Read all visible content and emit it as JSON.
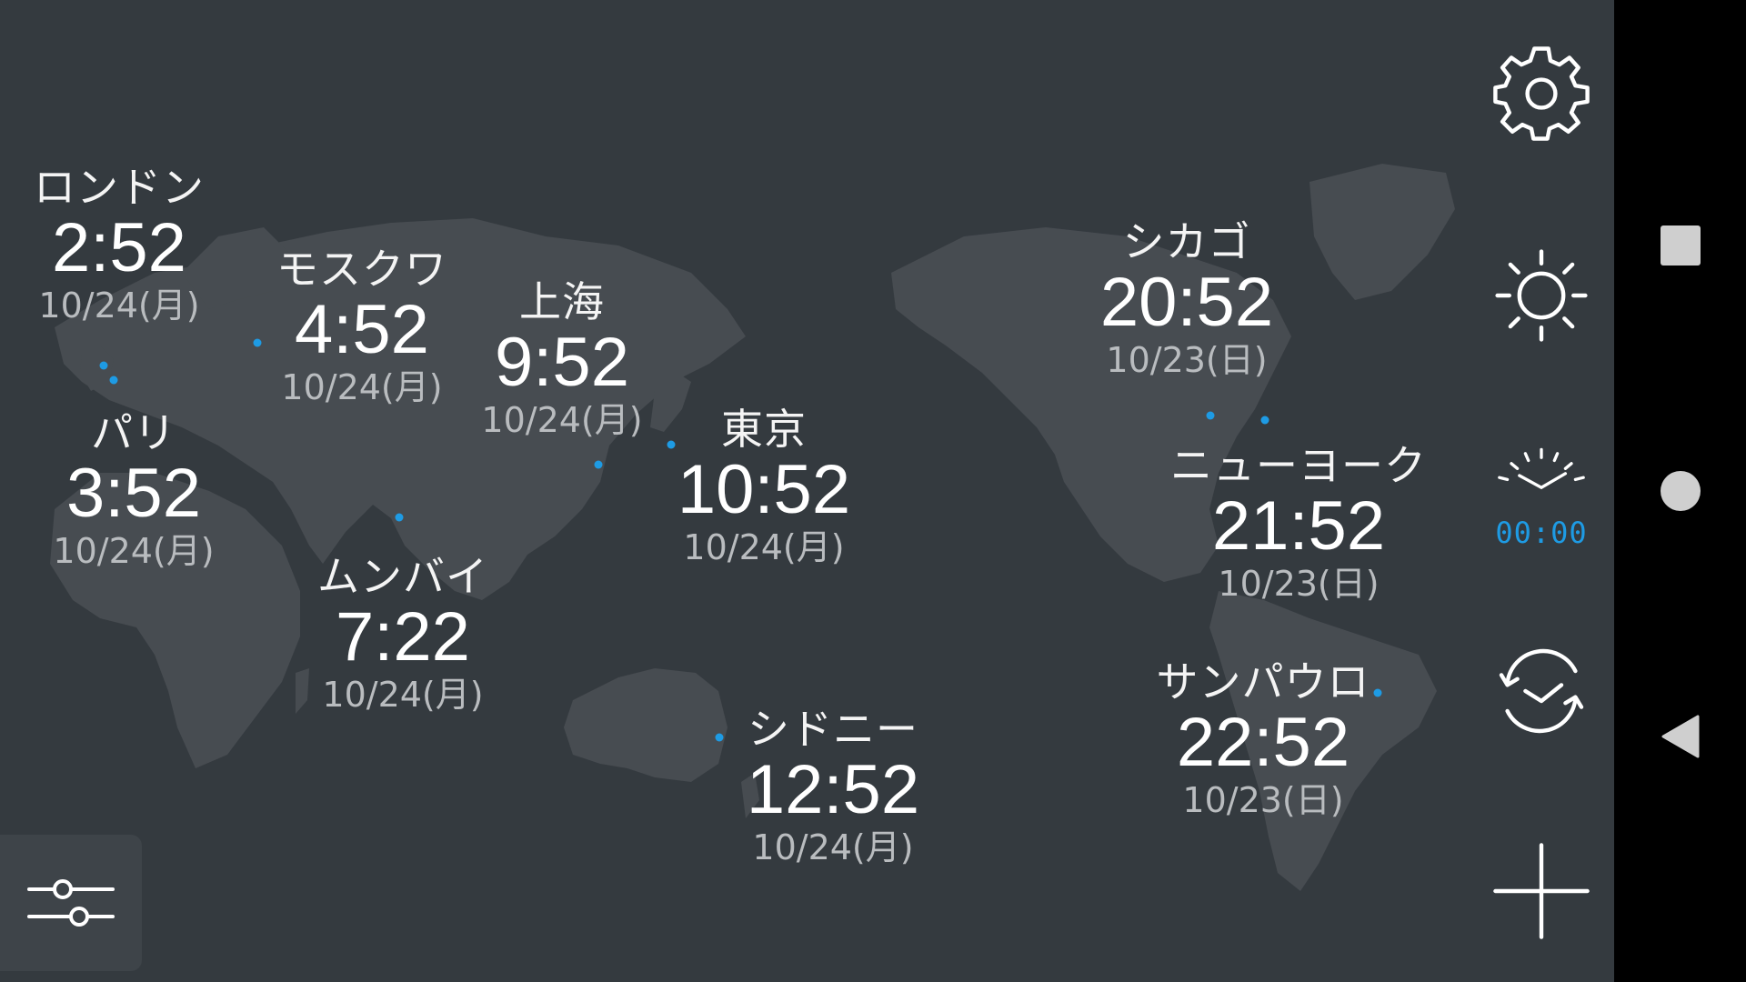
{
  "cities": [
    {
      "id": "london",
      "name": "ロンドン",
      "time": "2:52",
      "date": "10/24(月)"
    },
    {
      "id": "moscow",
      "name": "モスクワ",
      "time": "4:52",
      "date": "10/24(月)"
    },
    {
      "id": "shanghai",
      "name": "上海",
      "time": "9:52",
      "date": "10/24(月)"
    },
    {
      "id": "paris",
      "name": "パリ",
      "time": "3:52",
      "date": "10/24(月)"
    },
    {
      "id": "tokyo",
      "name": "東京",
      "time": "10:52",
      "date": "10/24(月)"
    },
    {
      "id": "mumbai",
      "name": "ムンバイ",
      "time": "7:22",
      "date": "10/24(月)"
    },
    {
      "id": "sydney",
      "name": "シドニー",
      "time": "12:52",
      "date": "10/24(月)"
    },
    {
      "id": "chicago",
      "name": "シカゴ",
      "time": "20:52",
      "date": "10/23(日)"
    },
    {
      "id": "newyork",
      "name": "ニューヨーク",
      "time": "21:52",
      "date": "10/23(日)"
    },
    {
      "id": "saopaulo",
      "name": "サンパウロ",
      "time": "22:52",
      "date": "10/23(日)"
    }
  ],
  "toolbar": {
    "settings_icon": "gear-icon",
    "brightness_icon": "sun-icon",
    "stopwatch_icon": "stopwatch-icon",
    "stopwatch_digits": "00:00",
    "timer_icon": "timer-icon",
    "add_icon": "plus-icon",
    "filter_icon": "sliders-icon"
  },
  "navigation": {
    "recents_icon": "square-icon",
    "home_icon": "circle-icon",
    "back_icon": "triangle-back-icon"
  },
  "colors": {
    "background": "#343a3f",
    "land": "#474c51",
    "accent": "#1e9be4",
    "navbar": "#000000"
  }
}
